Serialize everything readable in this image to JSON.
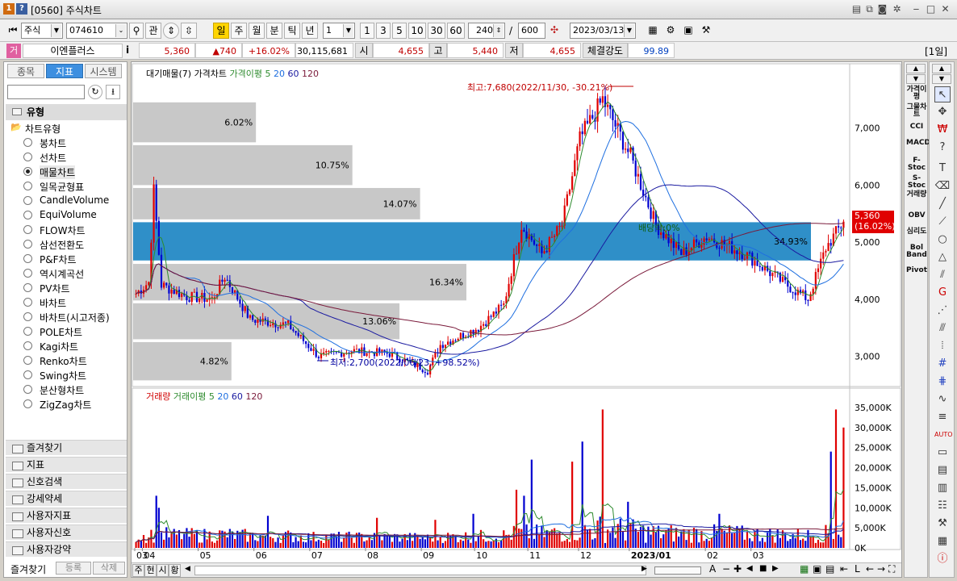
{
  "window": {
    "app_icon1": "1",
    "app_icon2": "?",
    "title": "[0560] 주식차트"
  },
  "toolbar": {
    "market": "주식",
    "code": "074610",
    "btn_kwan": "관",
    "periods": [
      "일",
      "주",
      "월",
      "분",
      "틱",
      "년"
    ],
    "active_period": "일",
    "unit_value": "1",
    "quick_units": [
      "1",
      "3",
      "5",
      "10",
      "30",
      "60"
    ],
    "display_count": "240",
    "slash": "/",
    "total_count": "600",
    "date": "2023/03/13"
  },
  "inforow": {
    "marker": "거",
    "stock_name": "이엔플러스",
    "info_i": "i",
    "price": "5,360",
    "change": "▲740",
    "change_pct": "+16.02%",
    "volume": "30,115,681",
    "open_label": "시",
    "open": "4,655",
    "high_label": "고",
    "high": "5,440",
    "low_label": "저",
    "low": "4,655",
    "strength_label": "체결강도",
    "strength": "99.89",
    "period_badge": "[1일]"
  },
  "leftpanel": {
    "tabs": [
      "종목",
      "지표",
      "시스템"
    ],
    "active_tab": "지표",
    "section": "유형",
    "tree_title": "차트유형",
    "chart_types": [
      "봉차트",
      "선차트",
      "매물차트",
      "일목균형표",
      "CandleVolume",
      "EquiVolume",
      "FLOW차트",
      "삼선전환도",
      "P&F차트",
      "역시계곡선",
      "PV차트",
      "바차트",
      "바차트(시고저종)",
      "POLE차트",
      "Kagi차트",
      "Renko차트",
      "Swing차트",
      "분산형차트",
      "ZigZag차트"
    ],
    "selected_type": "매물차트",
    "folders": [
      "즐겨찾기",
      "지표",
      "신호검색",
      "강세약세",
      "사용자지표",
      "사용자신호",
      "사용자강약"
    ],
    "bottom": {
      "fav": "즐겨찾기",
      "register": "등록",
      "delete": "삭제"
    }
  },
  "price_panel": {
    "legend": [
      "대기매물(7)",
      "가격차트",
      "가격이평",
      "5",
      "20",
      "60",
      "120"
    ],
    "legend_colors": [
      "#000000",
      "#000000",
      "#2e8b2e",
      "#2e8b2e",
      "#1e6fe0",
      "#1a1aa0",
      "#7a1a3a"
    ],
    "y_ticks": [
      "7,000",
      "6,000",
      "5,000",
      "4,000",
      "3,000"
    ],
    "y_tick_values": [
      7000,
      6000,
      5000,
      4000,
      3000
    ],
    "y_range": [
      2500,
      7900
    ],
    "current_price": "5,360",
    "current_pct": "(16.02%)",
    "high_note": "최고:7,680(2022/11/30, -30.21%)",
    "low_note": "최저:2,700(2022/06/23, +98.52%)",
    "dividend_note": "배당락:0%",
    "volume_profile": [
      {
        "pct": "6.02%",
        "value": 6.02,
        "lo": 6750,
        "hi": 7450
      },
      {
        "pct": "10.75%",
        "value": 10.75,
        "lo": 6000,
        "hi": 6700
      },
      {
        "pct": "14.07%",
        "value": 14.07,
        "lo": 5400,
        "hi": 5950
      },
      {
        "pct": "34.93%",
        "value": 34.93,
        "lo": 4680,
        "hi": 5350,
        "highlight": true
      },
      {
        "pct": "16.34%",
        "value": 16.34,
        "lo": 3980,
        "hi": 4620
      },
      {
        "pct": "13.06%",
        "value": 13.06,
        "lo": 3300,
        "hi": 3930
      },
      {
        "pct": "4.82%",
        "value": 4.82,
        "lo": 2580,
        "hi": 3250
      }
    ]
  },
  "volume_panel": {
    "legend": [
      "거래량",
      "거래이평",
      "5",
      "20",
      "60",
      "120"
    ],
    "legend_colors": [
      "#d00000",
      "#2e8b2e",
      "#2e8b2e",
      "#1e6fe0",
      "#1a1aa0",
      "#7a1a3a"
    ],
    "y_ticks": [
      "35,000K",
      "30,000K",
      "25,000K",
      "20,000K",
      "15,000K",
      "10,000K",
      "5,000K",
      "0K"
    ],
    "y_tick_values": [
      35000,
      30000,
      25000,
      20000,
      15000,
      10000,
      5000,
      0
    ],
    "y_max": 37000
  },
  "x_axis": {
    "labels": [
      "03",
      "04",
      "05",
      "06",
      "07",
      "08",
      "09",
      "10",
      "11",
      "12",
      "2023/01",
      "02",
      "03"
    ],
    "label_index": [
      0,
      3,
      25,
      47,
      69,
      91,
      113,
      134,
      155,
      175,
      195,
      225,
      243
    ]
  },
  "bottombar": {
    "tabs": [
      "주",
      "현",
      "시",
      "황"
    ]
  },
  "indicators": [
    "가격이평",
    "그물차트",
    "CCI",
    "MACD",
    "F-Stoc",
    "S-Stoc",
    "거래량",
    "OBV",
    "심리도",
    "Bol Band",
    "Pivot"
  ],
  "chart_data": {
    "type": "candlestick",
    "x": [
      "2022-03",
      "2022-04",
      "2022-05",
      "2022-06",
      "2022-07",
      "2022-08",
      "2022-09",
      "2022-10",
      "2022-11",
      "2022-12",
      "2023-01",
      "2023-02",
      "2023-03"
    ],
    "price_keypoints": [
      {
        "i": 0,
        "price": 4100
      },
      {
        "i": 5,
        "price": 4300
      },
      {
        "i": 7,
        "price": 5900
      },
      {
        "i": 10,
        "price": 4250
      },
      {
        "i": 20,
        "price": 4050
      },
      {
        "i": 30,
        "price": 4000
      },
      {
        "i": 35,
        "price": 4400
      },
      {
        "i": 45,
        "price": 3650
      },
      {
        "i": 60,
        "price": 3550
      },
      {
        "i": 72,
        "price": 3000
      },
      {
        "i": 85,
        "price": 3100
      },
      {
        "i": 100,
        "price": 3050
      },
      {
        "i": 115,
        "price": 2750
      },
      {
        "i": 120,
        "price": 3200
      },
      {
        "i": 135,
        "price": 3500
      },
      {
        "i": 145,
        "price": 3900
      },
      {
        "i": 152,
        "price": 5300
      },
      {
        "i": 160,
        "price": 4800
      },
      {
        "i": 168,
        "price": 5300
      },
      {
        "i": 175,
        "price": 6800
      },
      {
        "i": 184,
        "price": 7500
      },
      {
        "i": 195,
        "price": 6500
      },
      {
        "i": 205,
        "price": 5300
      },
      {
        "i": 215,
        "price": 4800
      },
      {
        "i": 225,
        "price": 5100
      },
      {
        "i": 240,
        "price": 4800
      },
      {
        "i": 255,
        "price": 4300
      },
      {
        "i": 265,
        "price": 4000
      },
      {
        "i": 272,
        "price": 4900
      },
      {
        "i": 279,
        "price": 5360
      }
    ],
    "n_days": 280,
    "volume_spikes": [
      {
        "i": 8,
        "vol": 13000
      },
      {
        "i": 9,
        "vol": 10000
      },
      {
        "i": 52,
        "vol": 8000
      },
      {
        "i": 95,
        "vol": 7500
      },
      {
        "i": 118,
        "vol": 7000
      },
      {
        "i": 133,
        "vol": 8500
      },
      {
        "i": 150,
        "vol": 14500
      },
      {
        "i": 153,
        "vol": 13000
      },
      {
        "i": 156,
        "vol": 22000
      },
      {
        "i": 172,
        "vol": 21500
      },
      {
        "i": 176,
        "vol": 26500
      },
      {
        "i": 184,
        "vol": 34500
      },
      {
        "i": 194,
        "vol": 11500
      },
      {
        "i": 230,
        "vol": 8500
      },
      {
        "i": 274,
        "vol": 24000
      },
      {
        "i": 276,
        "vol": 34500
      },
      {
        "i": 279,
        "vol": 30000
      }
    ],
    "ylim_price": [
      2500,
      7900
    ],
    "ylim_volume": [
      0,
      37000
    ],
    "legend_placement": "top-left"
  }
}
